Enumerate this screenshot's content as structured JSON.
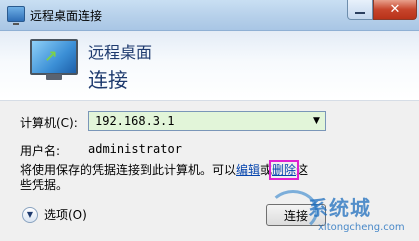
{
  "window": {
    "title": "远程桌面连接",
    "minimize_glyph": "—",
    "close_glyph": "✕"
  },
  "banner": {
    "line1": "远程桌面",
    "line2": "连接",
    "icon": "remote-desktop-monitor-icon"
  },
  "form": {
    "computer_label": "计算机(C):",
    "computer_value": "192.168.3.1",
    "dropdown_glyph": "▼",
    "username_label": "用户名:",
    "username_value": "administrator",
    "info_part1": "将使用保存的凭据连接到此计算机。可以",
    "edit_link": "编辑",
    "info_or": "或",
    "delete_link": "删除",
    "info_part2": "这",
    "info_line2": "些凭据。"
  },
  "footer": {
    "options_label": "选项(O)",
    "options_glyph": "▼",
    "connect_label": "连接"
  },
  "watermark": {
    "brand": "系统城",
    "url": "xitongcheng.com"
  },
  "colors": {
    "combo_background": "#e2f5d9",
    "highlight_outline": "#e020d0",
    "banner_text": "#1e3a6e"
  }
}
